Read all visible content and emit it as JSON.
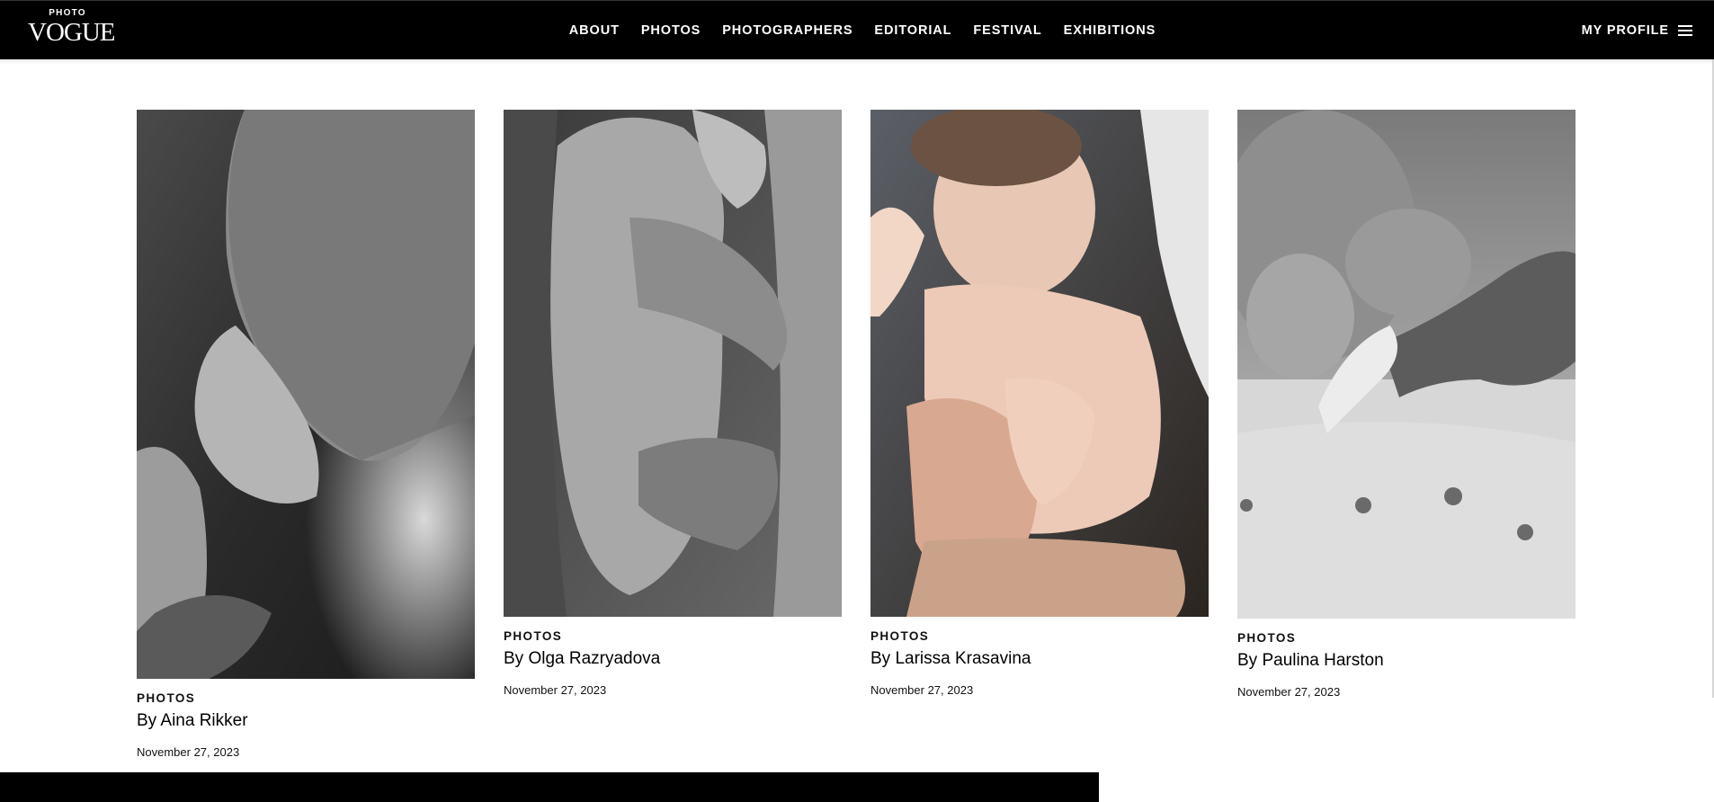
{
  "header": {
    "logo_small": "PHOTO",
    "logo_big": "VOGUE",
    "nav": [
      "ABOUT",
      "PHOTOS",
      "PHOTOGRAPHERS",
      "EDITORIAL",
      "FESTIVAL",
      "EXHIBITIONS"
    ],
    "profile_label": "MY PROFILE",
    "menu_icon": "hamburger-menu-icon"
  },
  "cards": [
    {
      "rubric": "PHOTOS",
      "title": "By Aina Rikker",
      "date": "November 27, 2023",
      "image_icon": "man-kissing-baby-foot-photo"
    },
    {
      "rubric": "PHOTOS",
      "title": "By Olga Razryadova",
      "date": "November 27, 2023",
      "image_icon": "baby-held-on-shoulder-photo"
    },
    {
      "rubric": "PHOTOS",
      "title": "By Larissa Krasavina",
      "date": "November 27, 2023",
      "image_icon": "baby-sitting-in-hands-photo"
    },
    {
      "rubric": "PHOTOS",
      "title": "By Paulina Harston",
      "date": "November 27, 2023",
      "image_icon": "baby-holding-finger-photo"
    }
  ],
  "colors": {
    "header_bg": "#000000",
    "page_bg": "#ffffff",
    "text": "#111111"
  }
}
